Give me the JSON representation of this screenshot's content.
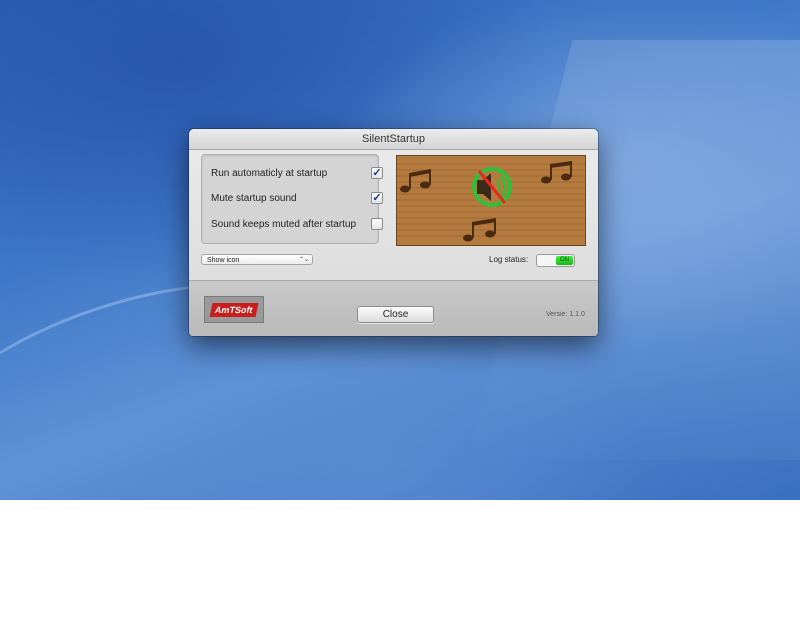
{
  "window": {
    "title": "SilentStartup"
  },
  "options": [
    {
      "label": "Run automaticly at startup",
      "checked": true
    },
    {
      "label": "Mute startup sound",
      "checked": true
    },
    {
      "label": "Sound keeps muted after startup",
      "checked": false
    }
  ],
  "display_select": {
    "value": "Show icon",
    "arrows": "⌃⌄"
  },
  "log": {
    "label": "Log status:",
    "state": "ON"
  },
  "footer": {
    "logo_text": "AmTSoft",
    "close_label": "Close",
    "version": "Versie: 1.1.0"
  },
  "icons": {
    "check": "✓",
    "art": "muted-speaker-music-notes-icon"
  },
  "colors": {
    "wood": "#b57a3e",
    "toggle_on": "#2ad52a",
    "logo_red": "#c81e1e",
    "mute_ring": "#2fbf3a"
  }
}
